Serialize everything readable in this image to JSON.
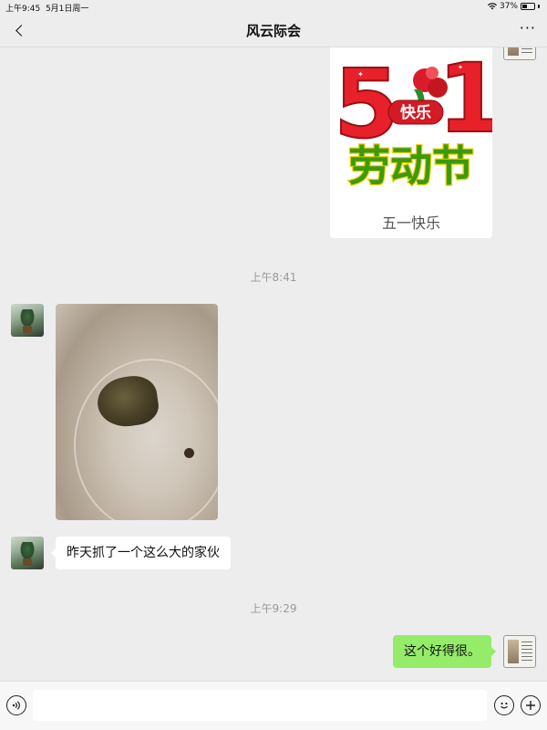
{
  "status_bar": {
    "time": "上午9:45",
    "date": "5月1日周一",
    "battery": "37%"
  },
  "header": {
    "title": "风云际会",
    "back_icon": "chevron-left-icon",
    "more_label": "···"
  },
  "sticker": {
    "big_text": "51",
    "badge_text": "快乐",
    "headline": "劳动节",
    "caption": "五一快乐"
  },
  "timestamps": {
    "first": "上午8:41",
    "second": "上午9:29"
  },
  "messages": {
    "text_left": "昨天抓了一个这么大的家伙",
    "text_right": "这个好得很。"
  },
  "colors": {
    "bubble_sent": "#95ec69",
    "bubble_received": "#ffffff",
    "background": "#ededed"
  },
  "input_bar": {
    "value": "",
    "voice_icon": "voice-icon",
    "emoji_icon": "emoji-icon",
    "plus_icon": "plus-icon"
  }
}
